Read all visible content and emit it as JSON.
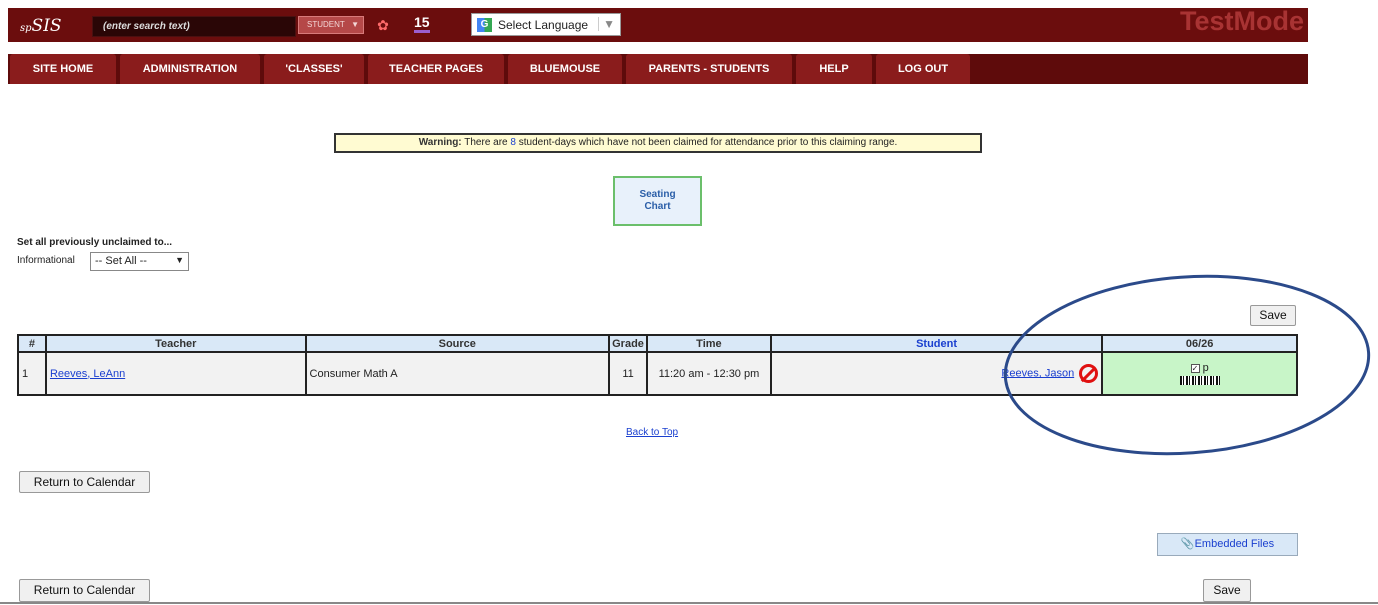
{
  "header": {
    "logo_prefix": "sp",
    "logo_main": "SIS",
    "search_placeholder": "(enter search text)",
    "search_mode": "STUDENT",
    "count_badge": "15",
    "language_label": "Select Language",
    "mode_banner": "TestMode"
  },
  "nav": {
    "items": [
      {
        "label": "SITE HOME"
      },
      {
        "label": "ADMINISTRATION"
      },
      {
        "label": "'CLASSES'"
      },
      {
        "label": "TEACHER PAGES"
      },
      {
        "label": "BLUEMOUSE"
      },
      {
        "label": "PARENTS - STUDENTS"
      },
      {
        "label": "HELP"
      },
      {
        "label": "LOG OUT"
      }
    ]
  },
  "warning": {
    "prefix": "Warning:",
    "text_before": "There are",
    "count": "8",
    "text_after": "student-days which have not been claimed for attendance prior to this claiming range."
  },
  "seating_chart": {
    "line1": "Seating",
    "line2": "Chart"
  },
  "set_all": {
    "label": "Set all previously unclaimed to...",
    "type_label": "Informational",
    "selected": "-- Set All --"
  },
  "buttons": {
    "save": "Save",
    "return_calendar": "Return to Calendar",
    "embedded_files": "Embedded Files"
  },
  "table": {
    "headers": [
      "#",
      "Teacher",
      "Source",
      "Grade",
      "Time",
      "Student",
      "06/26"
    ],
    "row": {
      "num": "1",
      "teacher": "Reeves, LeAnn",
      "source": "Consumer Math A",
      "grade": "11",
      "time": "11:20 am - 12:30 pm",
      "student": "Reeves, Jason",
      "status": "p"
    }
  },
  "back_to_top": "Back to Top",
  "colors": {
    "header_bg": "#6b0d0d",
    "nav_tab": "#8a1c1c",
    "present_cell": "#c8f5c8",
    "warning_bg": "#fffbd2",
    "highlight_ellipse": "#2b4a8a"
  }
}
